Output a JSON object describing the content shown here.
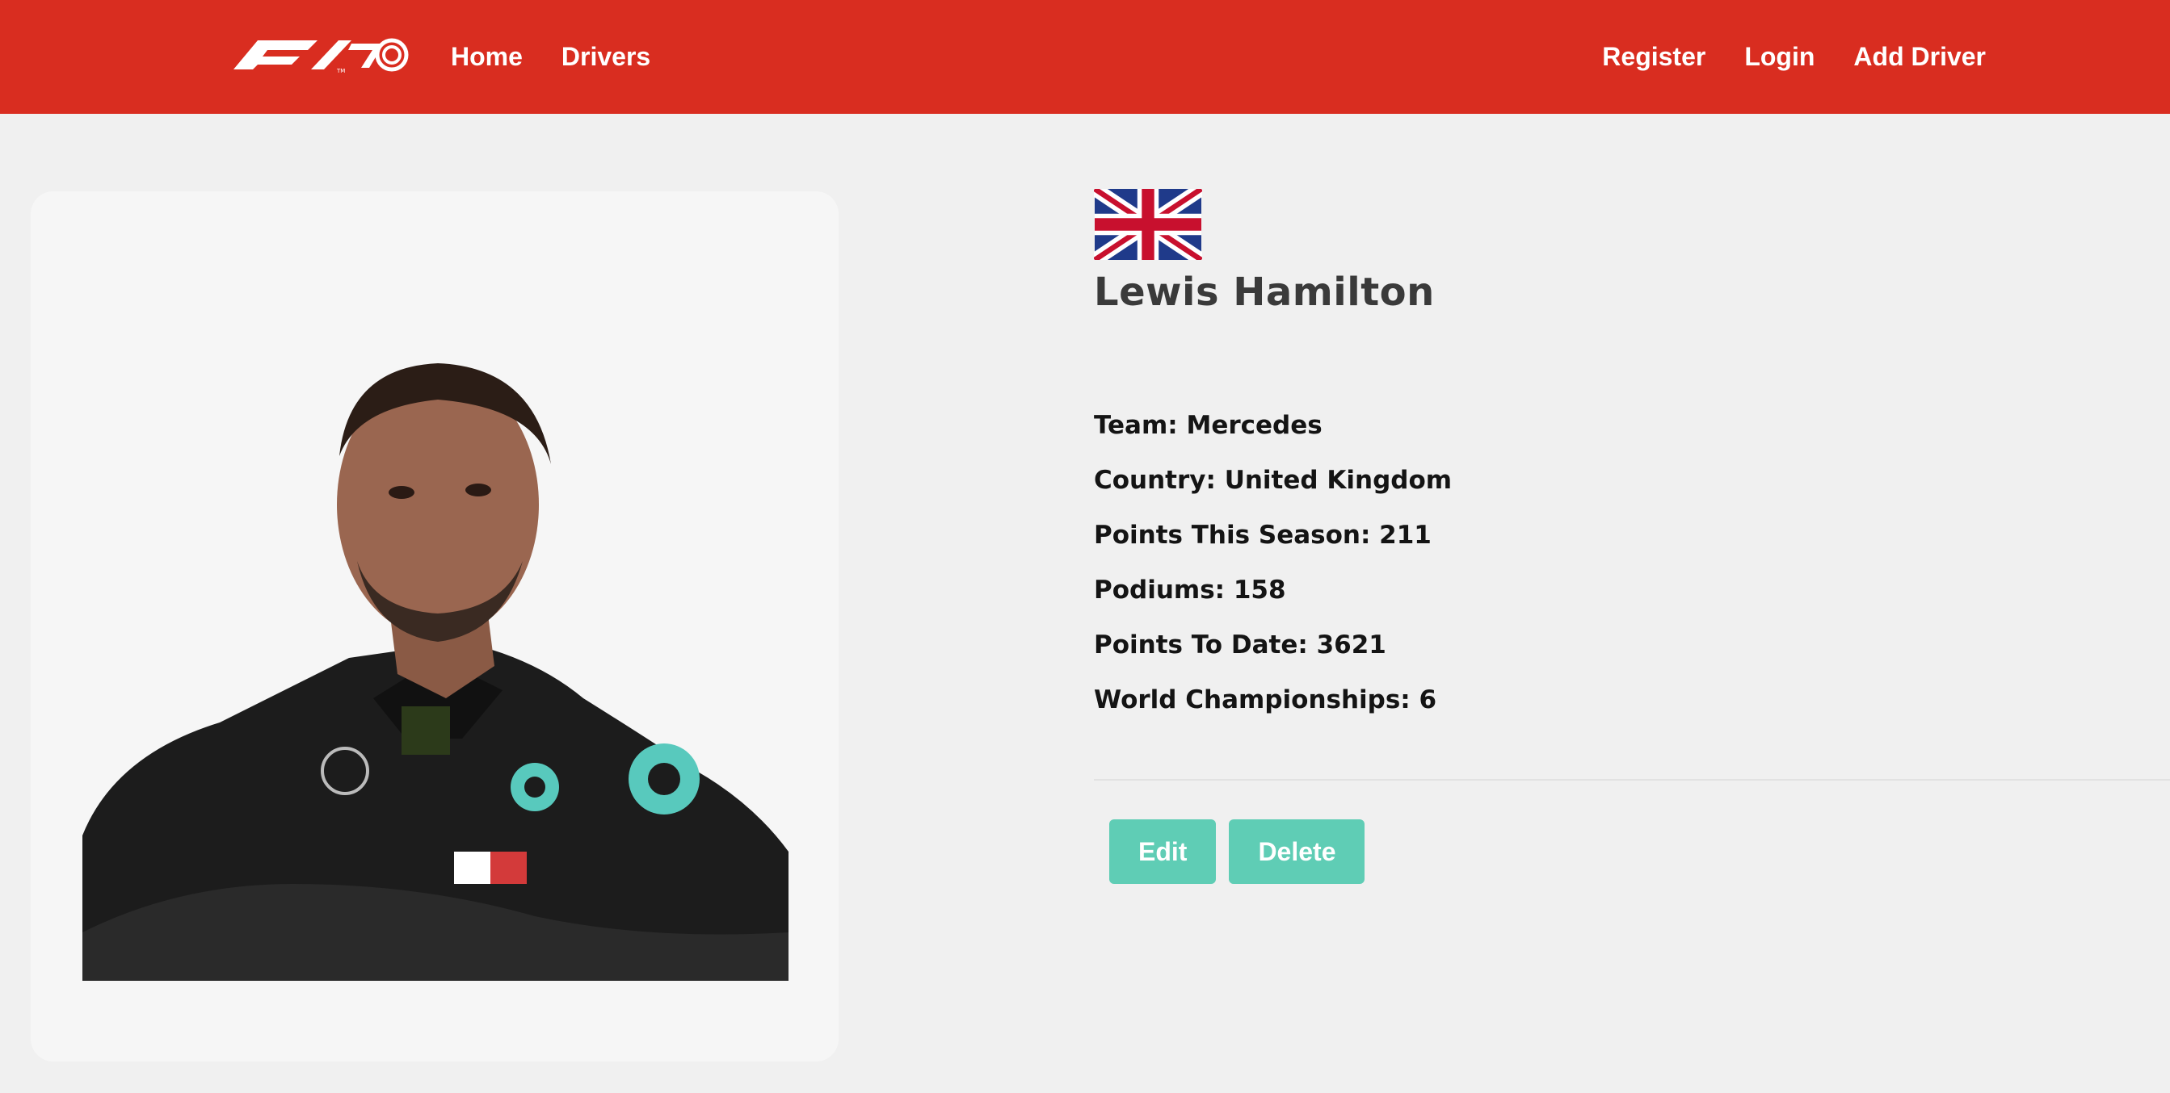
{
  "navbar": {
    "logo_icon": "f1-70-logo",
    "brand_color": "#d92d20",
    "left_links": [
      {
        "label": "Home"
      },
      {
        "label": "Drivers"
      }
    ],
    "right_links": [
      {
        "label": "Register"
      },
      {
        "label": "Login"
      },
      {
        "label": "Add Driver"
      }
    ]
  },
  "driver": {
    "flag_icon": "united-kingdom-flag",
    "photo_icon": "driver-portrait",
    "name": "Lewis Hamilton",
    "stats": [
      {
        "text": "Team: Mercedes"
      },
      {
        "text": "Country: United Kingdom"
      },
      {
        "text": "Points This Season: 211"
      },
      {
        "text": "Podiums: 158"
      },
      {
        "text": "Points To Date: 3621"
      },
      {
        "text": "World Championships: 6"
      }
    ]
  },
  "actions": {
    "edit_label": "Edit",
    "delete_label": "Delete",
    "button_color": "#5fcdb5"
  }
}
